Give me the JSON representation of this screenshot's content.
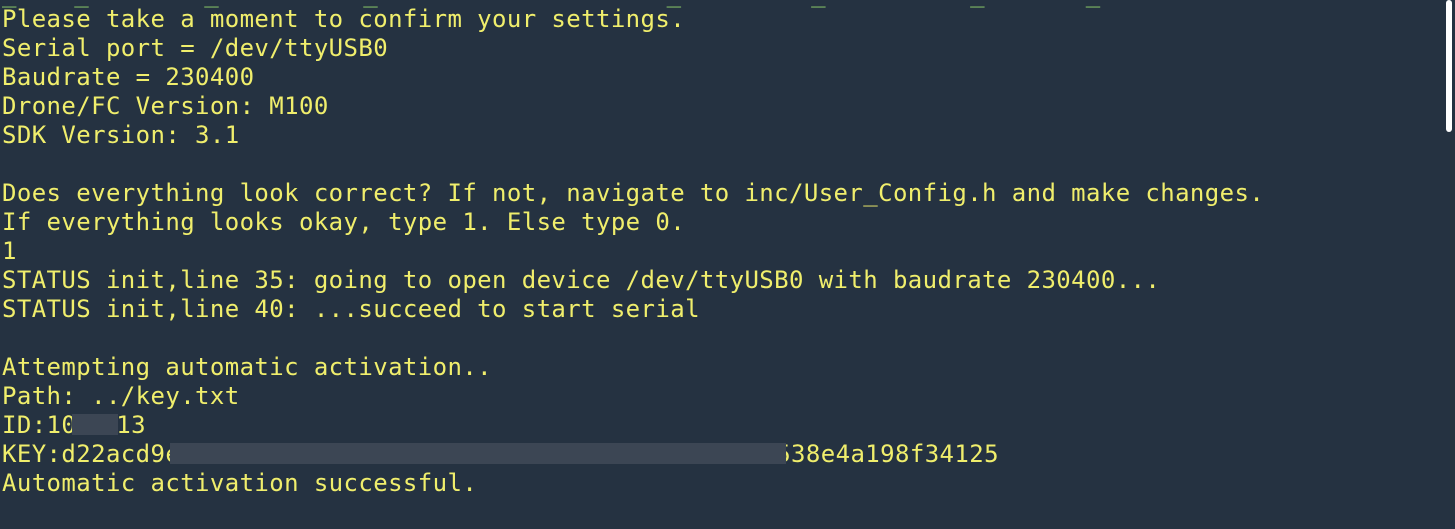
{
  "terminal": {
    "cut_off_line": "_    _        _          _                    _         _          _       _",
    "lines": [
      "Please take a moment to confirm your settings.",
      "Serial port = /dev/ttyUSB0",
      "Baudrate = 230400",
      "Drone/FC Version: M100",
      "SDK Version: 3.1",
      "",
      "Does everything look correct? If not, navigate to inc/User_Config.h and make changes.",
      "If everything looks okay, type 1. Else type 0.",
      "1",
      "STATUS init,line 35: going to open device /dev/ttyUSB0 with baudrate 230400...",
      "STATUS init,line 40: ...succeed to start serial",
      "",
      "Attempting automatic activation..",
      "Path: ../key.txt"
    ],
    "id_line": {
      "prefix": "ID:10",
      "suffix": "13"
    },
    "key_line": {
      "prefix": "KEY:d22acd9e",
      "suffix": "538e4a198f34125"
    },
    "final_line": "Automatic activation successful."
  },
  "colors": {
    "background": "#253241",
    "text": "#f0ee6c",
    "redaction": "#3c4654"
  }
}
